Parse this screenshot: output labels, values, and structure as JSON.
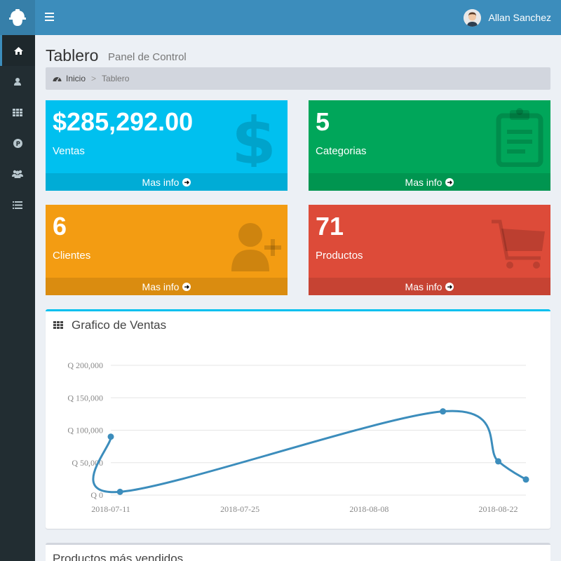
{
  "header": {
    "user_name": "Allan Sanchez"
  },
  "page": {
    "title": "Tablero",
    "subtitle": "Panel de Control"
  },
  "breadcrumb": {
    "home": "Inicio",
    "separator": ">",
    "current": "Tablero"
  },
  "sidebar": {
    "items": [
      {
        "icon": "home-icon"
      },
      {
        "icon": "user-icon"
      },
      {
        "icon": "th-icon"
      },
      {
        "icon": "product-icon"
      },
      {
        "icon": "users-icon"
      },
      {
        "icon": "list-icon"
      }
    ]
  },
  "boxes": [
    {
      "value": "$285,292.00",
      "label": "Ventas",
      "footer": "Mas info",
      "color": "#00c0ef",
      "icon": "dollar-icon"
    },
    {
      "value": "5",
      "label": "Categorias",
      "footer": "Mas info",
      "color": "#00a65a",
      "icon": "clipboard-icon"
    },
    {
      "value": "6",
      "label": "Clientes",
      "footer": "Mas info",
      "color": "#f39c12",
      "icon": "user-plus-icon"
    },
    {
      "value": "71",
      "label": "Productos",
      "footer": "Mas info",
      "color": "#dd4b39",
      "icon": "cart-icon"
    }
  ],
  "chart_panel": {
    "title": "Grafico de Ventas"
  },
  "chart_data": {
    "type": "line",
    "x_ticks": [
      "2018-07-11",
      "2018-07-25",
      "2018-08-08",
      "2018-08-22"
    ],
    "y_ticks": [
      "Q 0",
      "Q 50,000",
      "Q 100,000",
      "Q 150,000",
      "Q 200,000"
    ],
    "ylim": [
      0,
      200000
    ],
    "x_range": [
      "2018-07-11",
      "2018-08-25"
    ],
    "points": [
      {
        "x": "2018-07-11",
        "y": 90000
      },
      {
        "x": "2018-07-12",
        "y": 5000
      },
      {
        "x": "2018-08-16",
        "y": 129000
      },
      {
        "x": "2018-08-22",
        "y": 52000
      },
      {
        "x": "2018-08-25",
        "y": 24000
      }
    ],
    "line_color": "#3c8dbc",
    "grid": true
  },
  "panel2": {
    "title": "Productos más vendidos"
  }
}
